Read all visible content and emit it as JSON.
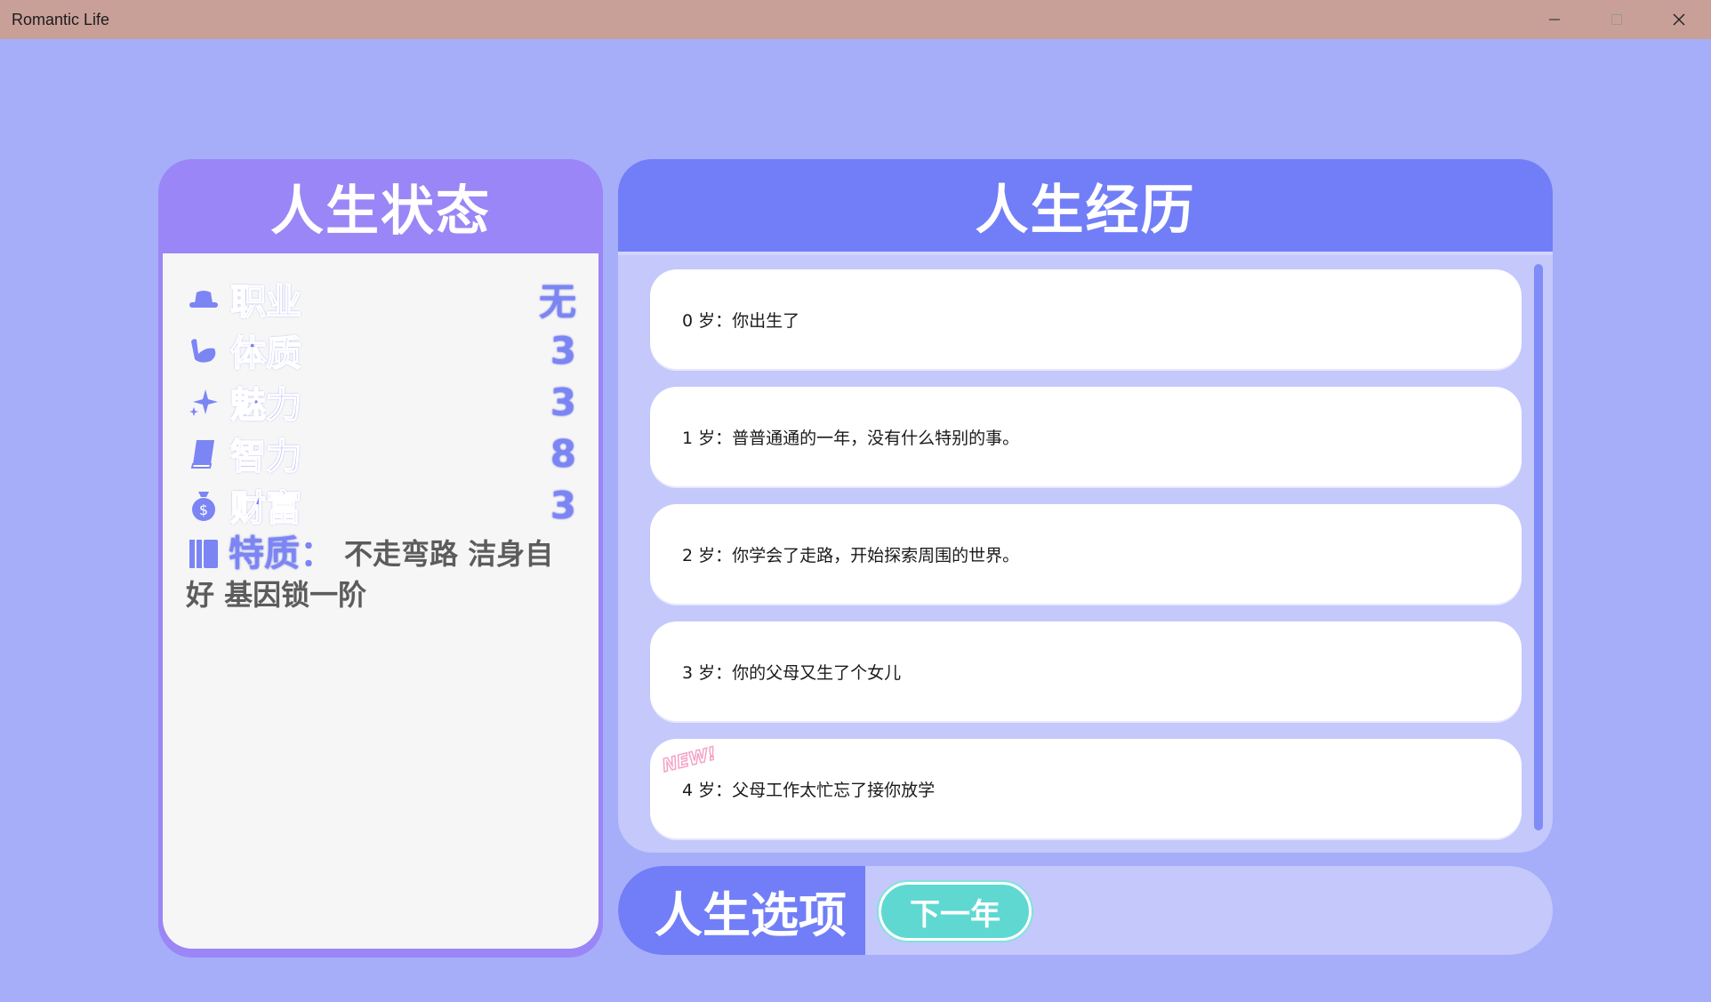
{
  "window": {
    "title": "Romantic Life"
  },
  "status_panel": {
    "title": "人生状态",
    "stats": [
      {
        "icon": "hat-icon",
        "label": "职业",
        "value": "无"
      },
      {
        "icon": "muscle-icon",
        "label": "体质",
        "value": "3"
      },
      {
        "icon": "sparkle-icon",
        "label": "魅力",
        "value": "3"
      },
      {
        "icon": "book-icon",
        "label": "智力",
        "value": "8"
      },
      {
        "icon": "money-bag-icon",
        "label": "财富",
        "value": "3"
      }
    ],
    "trait": {
      "icon": "books-icon",
      "label": "特质",
      "colon": "：",
      "text": "不走弯路 洁身自好 基因锁一阶"
    }
  },
  "experience_panel": {
    "title": "人生经历",
    "entries": [
      {
        "text": "0 岁：你出生了",
        "new": false
      },
      {
        "text": "1 岁：普普通通的一年，没有什么特别的事。",
        "new": false
      },
      {
        "text": "2 岁：你学会了走路，开始探索周围的世界。",
        "new": false
      },
      {
        "text": "3 岁：你的父母又生了个女儿",
        "new": false
      },
      {
        "text": "4 岁：父母工作太忙忘了接你放学",
        "new": true
      }
    ],
    "new_badge": "NEW!"
  },
  "options_panel": {
    "title": "人生选项",
    "next_button": "下一年"
  },
  "colors": {
    "background": "#a6aefa",
    "panel_header": "#717ef7",
    "left_header": "#9a86f6",
    "accent_text": "#7b85f4",
    "button": "#5fd8d2"
  }
}
